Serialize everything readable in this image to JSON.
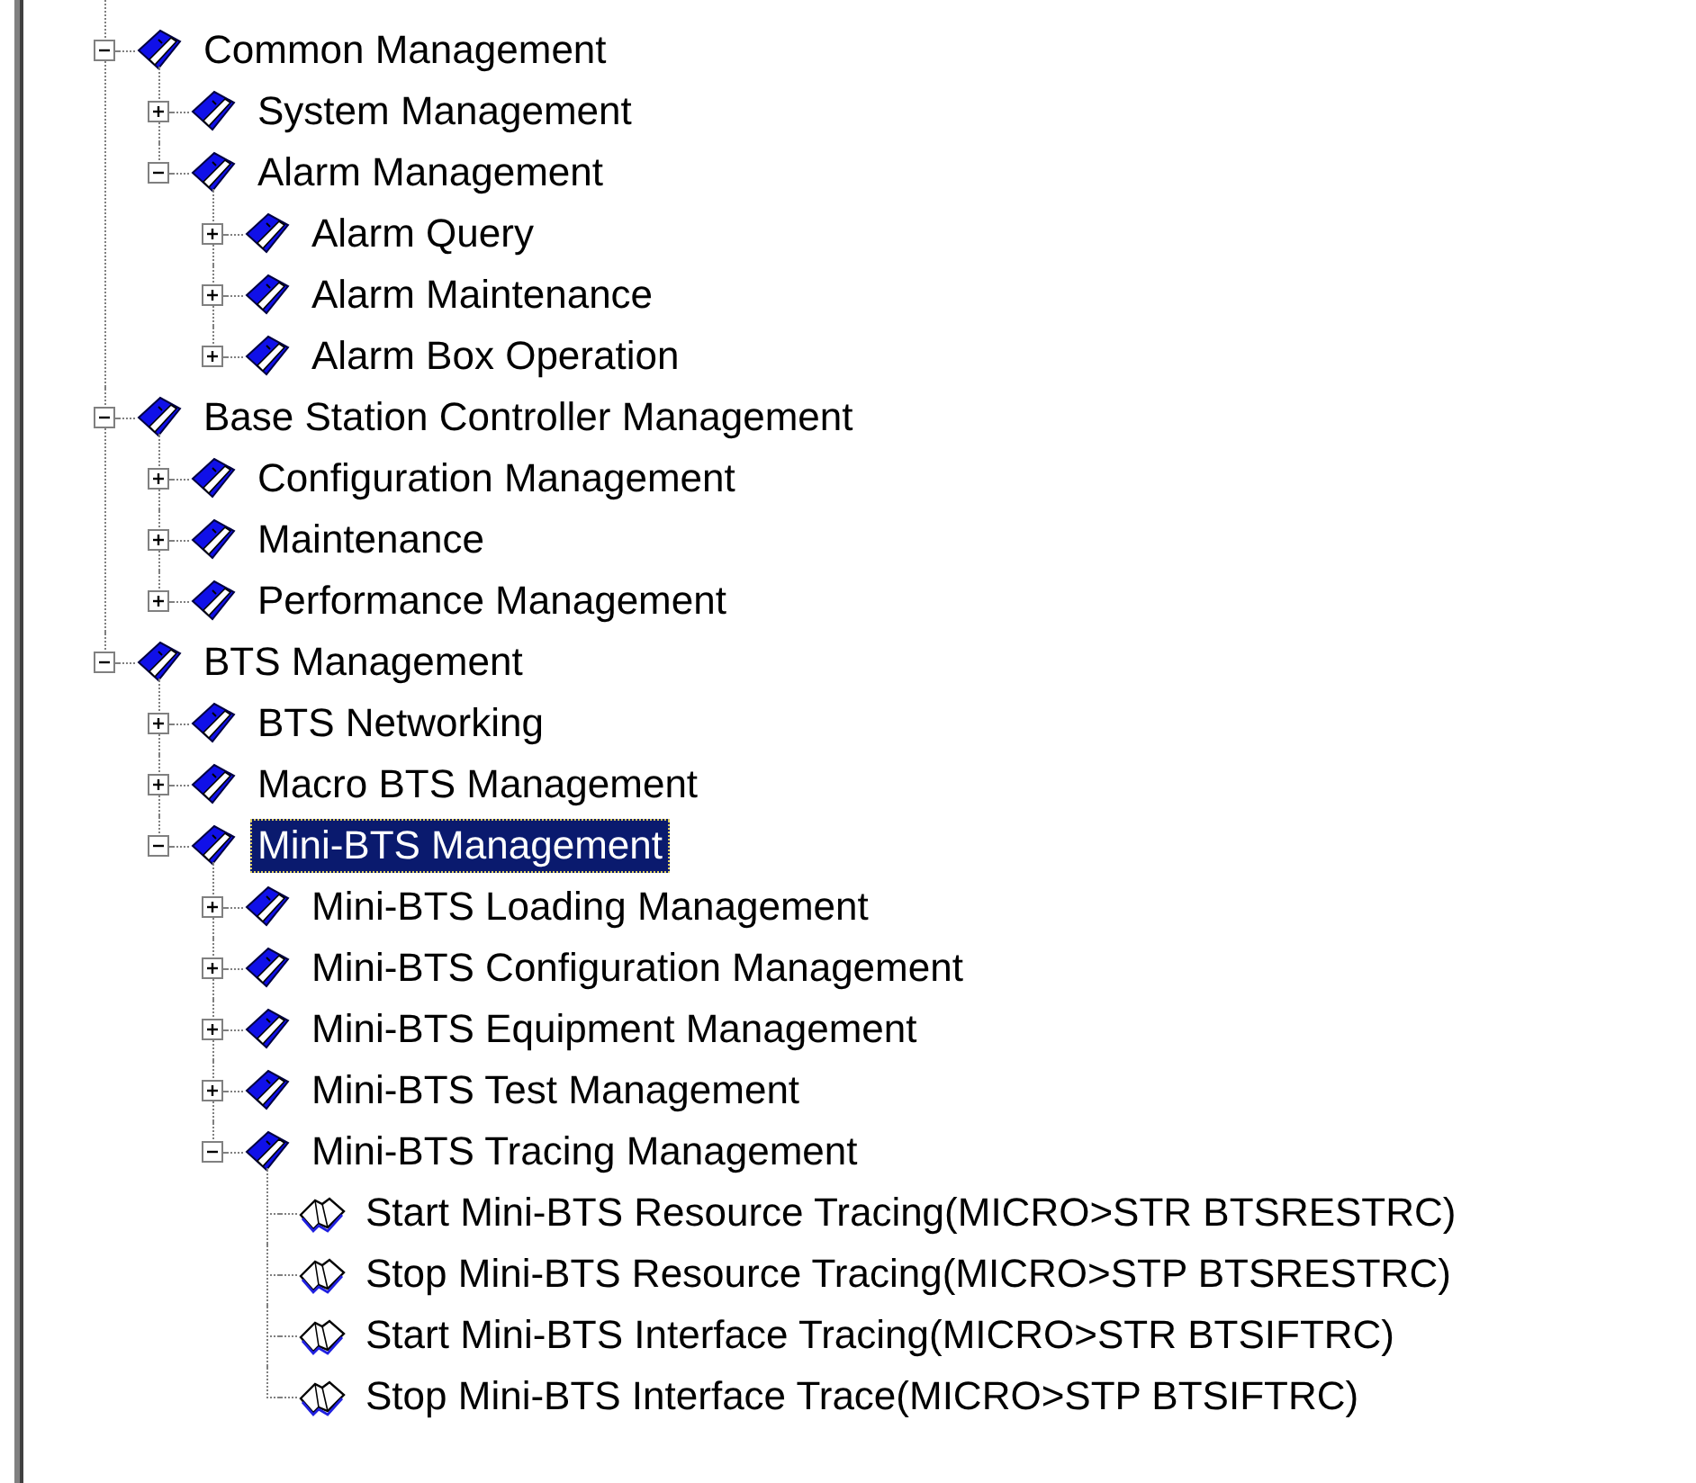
{
  "tree": [
    {
      "label": "Common Management",
      "kind": "folder",
      "expanded": true,
      "selected": false,
      "children": [
        {
          "label": "System Management",
          "kind": "folder",
          "expanded": false,
          "selected": false
        },
        {
          "label": "Alarm Management",
          "kind": "folder",
          "expanded": true,
          "selected": false,
          "children": [
            {
              "label": "Alarm Query",
              "kind": "folder",
              "expanded": false,
              "selected": false
            },
            {
              "label": "Alarm Maintenance",
              "kind": "folder",
              "expanded": false,
              "selected": false
            },
            {
              "label": "Alarm Box Operation",
              "kind": "folder",
              "expanded": false,
              "selected": false
            }
          ]
        }
      ]
    },
    {
      "label": "Base Station Controller Management",
      "kind": "folder",
      "expanded": true,
      "selected": false,
      "children": [
        {
          "label": "Configuration Management",
          "kind": "folder",
          "expanded": false,
          "selected": false
        },
        {
          "label": "Maintenance",
          "kind": "folder",
          "expanded": false,
          "selected": false
        },
        {
          "label": "Performance Management",
          "kind": "folder",
          "expanded": false,
          "selected": false
        }
      ]
    },
    {
      "label": "BTS Management",
      "kind": "folder",
      "expanded": true,
      "selected": false,
      "children": [
        {
          "label": "BTS Networking",
          "kind": "folder",
          "expanded": false,
          "selected": false
        },
        {
          "label": "Macro BTS Management",
          "kind": "folder",
          "expanded": false,
          "selected": false
        },
        {
          "label": "Mini-BTS Management",
          "kind": "folder",
          "expanded": true,
          "selected": true,
          "children": [
            {
              "label": "Mini-BTS Loading Management",
              "kind": "folder",
              "expanded": false,
              "selected": false
            },
            {
              "label": "Mini-BTS Configuration Management",
              "kind": "folder",
              "expanded": false,
              "selected": false
            },
            {
              "label": "Mini-BTS Equipment Management",
              "kind": "folder",
              "expanded": false,
              "selected": false
            },
            {
              "label": "Mini-BTS Test Management",
              "kind": "folder",
              "expanded": false,
              "selected": false
            },
            {
              "label": "Mini-BTS Tracing Management",
              "kind": "folder",
              "expanded": true,
              "selected": false,
              "children": [
                {
                  "label": "Start Mini-BTS Resource Tracing(MICRO>STR BTSRESTRC)",
                  "kind": "command",
                  "selected": false
                },
                {
                  "label": "Stop Mini-BTS Resource Tracing(MICRO>STP BTSRESTRC)",
                  "kind": "command",
                  "selected": false
                },
                {
                  "label": "Start Mini-BTS Interface Tracing(MICRO>STR BTSIFTRC)",
                  "kind": "command",
                  "selected": false
                },
                {
                  "label": "Stop Mini-BTS Interface Trace(MICRO>STP BTSIFTRC)",
                  "kind": "command",
                  "selected": false
                }
              ]
            }
          ]
        }
      ]
    }
  ]
}
